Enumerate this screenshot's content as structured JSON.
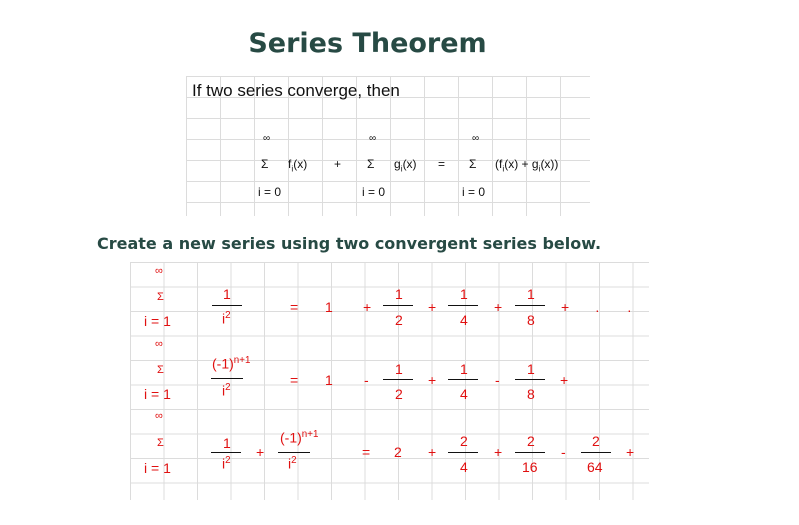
{
  "title": "Series Theorem",
  "intro": "If two series converge, then",
  "theorem": {
    "inf": "∞",
    "sigma": "Σ",
    "lower": "i = 0",
    "f": "f",
    "g": "g",
    "sub_i": "i",
    "arg": "(x)",
    "plus": "+",
    "equals": "=",
    "sum_open": "(f",
    "sum_mid": "(x) + g",
    "sum_close": "(x))"
  },
  "subtitle": "Create a new series using two convergent series below.",
  "examples": {
    "inf": "∞",
    "sigma": "Σ",
    "lower": "i = 1",
    "one": "1",
    "i": "i",
    "sq": "2",
    "neg_one": "(-1)",
    "exp": "n+1",
    "plus": "+",
    "minus": "-",
    "equals": "=",
    "dot": "·",
    "row1": {
      "lead": "1",
      "terms": [
        {
          "num": "1",
          "den": "2"
        },
        {
          "num": "1",
          "den": "4"
        },
        {
          "num": "1",
          "den": "8"
        }
      ]
    },
    "row2": {
      "lead": "1",
      "terms": [
        {
          "num": "1",
          "den": "2"
        },
        {
          "num": "1",
          "den": "4"
        },
        {
          "num": "1",
          "den": "8"
        }
      ]
    },
    "row3": {
      "lead": "2",
      "terms": [
        {
          "num": "2",
          "den": "4"
        },
        {
          "num": "2",
          "den": "16"
        },
        {
          "num": "2",
          "den": "64"
        }
      ]
    }
  }
}
